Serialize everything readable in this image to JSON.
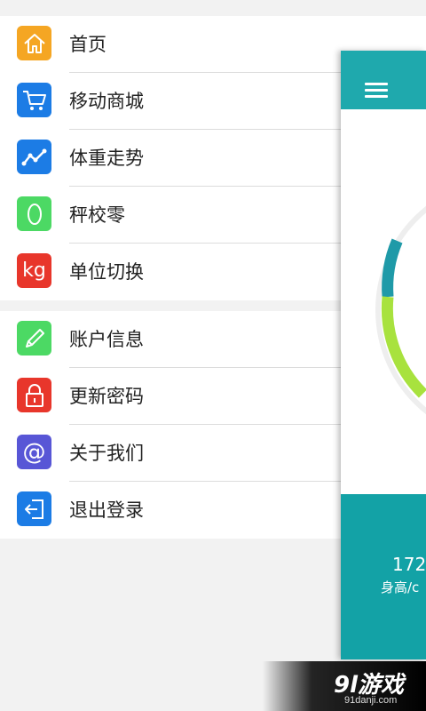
{
  "menu": {
    "group1": [
      {
        "label": "首页",
        "icon": "home-icon",
        "color": "#f5a623"
      },
      {
        "label": "移动商城",
        "icon": "cart-icon",
        "color": "#1c7ce5"
      },
      {
        "label": "体重走势",
        "icon": "trend-icon",
        "color": "#1c7ce5"
      },
      {
        "label": "秤校零",
        "icon": "zero-icon",
        "color": "#4cd964"
      },
      {
        "label": "单位切换",
        "icon": "kg-icon",
        "icon_text": "kg",
        "color": "#e8362b"
      }
    ],
    "group2": [
      {
        "label": "账户信息",
        "icon": "pencil-icon",
        "color": "#4cd964"
      },
      {
        "label": "更新密码",
        "icon": "lock-icon",
        "color": "#e8362b"
      },
      {
        "label": "关于我们",
        "icon": "at-icon",
        "icon_text": "@",
        "color": "#5856d6"
      },
      {
        "label": "退出登录",
        "icon": "logout-icon",
        "color": "#1c7ce5"
      }
    ]
  },
  "panel": {
    "header_color": "#1fa9ad",
    "footer_color": "#13a2a6",
    "height_value": "172",
    "height_label": "身高/c",
    "gauge_colors": {
      "teal": "#1f9aa8",
      "lime": "#a8e23e"
    }
  },
  "watermark": {
    "logo": "9l游戏",
    "url": "91danji.com"
  }
}
